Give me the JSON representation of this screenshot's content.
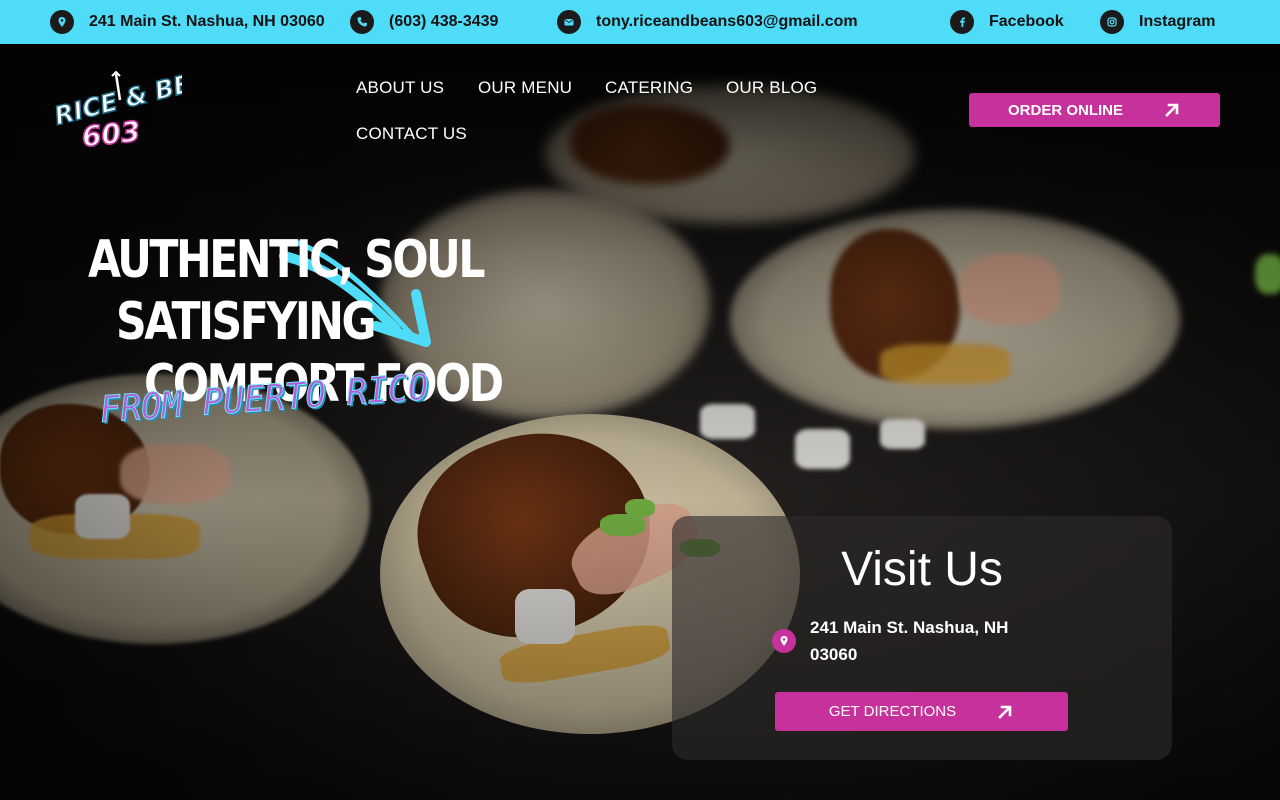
{
  "colors": {
    "topbar_bg": "#4edcf8",
    "accent_pink": "#c6319c",
    "text_dark": "#131313",
    "text_light": "#ffffff"
  },
  "topbar": {
    "address": {
      "icon": "map-marker-icon",
      "text": "241 Main St. Nashua, NH 03060"
    },
    "phone": {
      "icon": "phone-icon",
      "text": "(603) 438-3439"
    },
    "email": {
      "icon": "envelope-icon",
      "text": "tony.riceandbeans603@gmail.com"
    },
    "facebook": {
      "icon": "facebook-icon",
      "text": "Facebook"
    },
    "instagram": {
      "icon": "instagram-icon",
      "text": "Instagram"
    }
  },
  "header": {
    "logo": {
      "line1": "RICE & BEANS",
      "line2": "603"
    },
    "nav": [
      {
        "label": "ABOUT US"
      },
      {
        "label": "OUR MENU"
      },
      {
        "label": "CATERING"
      },
      {
        "label": "OUR BLOG"
      },
      {
        "label": "CONTACT US"
      }
    ],
    "order_button": {
      "label": "ORDER ONLINE",
      "icon": "arrow-up-right-icon"
    }
  },
  "hero": {
    "headline": {
      "line1": "AUTHENTIC, SOUL",
      "line2": "SATISFYING",
      "line3": "COMFORT FOOD",
      "script": "FROM PUERTO RICO"
    }
  },
  "visit": {
    "title": "Visit Us",
    "icon": "map-marker-icon",
    "address": "241 Main St. Nashua, NH 03060",
    "button": {
      "label": "GET DIRECTIONS",
      "icon": "arrow-up-right-icon"
    }
  }
}
